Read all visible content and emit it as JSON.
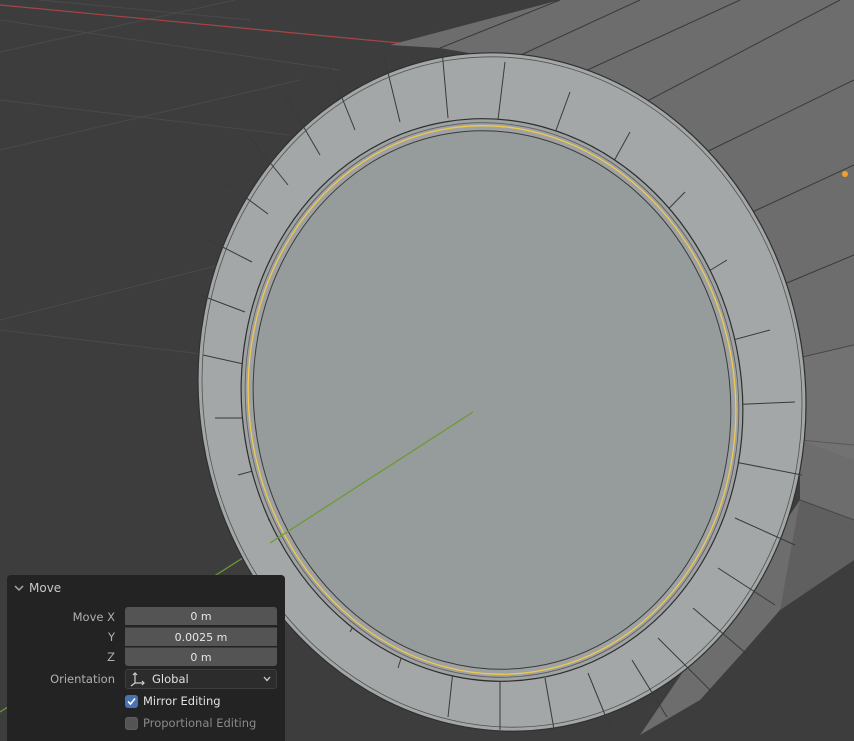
{
  "colors": {
    "background": "#3d3d3d",
    "mesh_face": "#959a9b",
    "edge_select": "#f2c84b",
    "axis_x": "#c24848",
    "axis_y": "#6d9a2e",
    "checkbox_accent": "#4772b3"
  },
  "redo_panel": {
    "title": "Move",
    "collapse_icon": "chevron-down-icon",
    "move_x_label": "Move X",
    "move_x_value": "0 m",
    "y_label": "Y",
    "y_value": "0.0025 m",
    "z_label": "Z",
    "z_value": "0 m",
    "orientation_label": "Orientation",
    "orientation_value": "Global",
    "orientation_icon": "global-axes-icon",
    "mirror_editing_label": "Mirror Editing",
    "mirror_editing_checked": true,
    "proportional_editing_label": "Proportional Editing",
    "proportional_editing_checked": false
  }
}
